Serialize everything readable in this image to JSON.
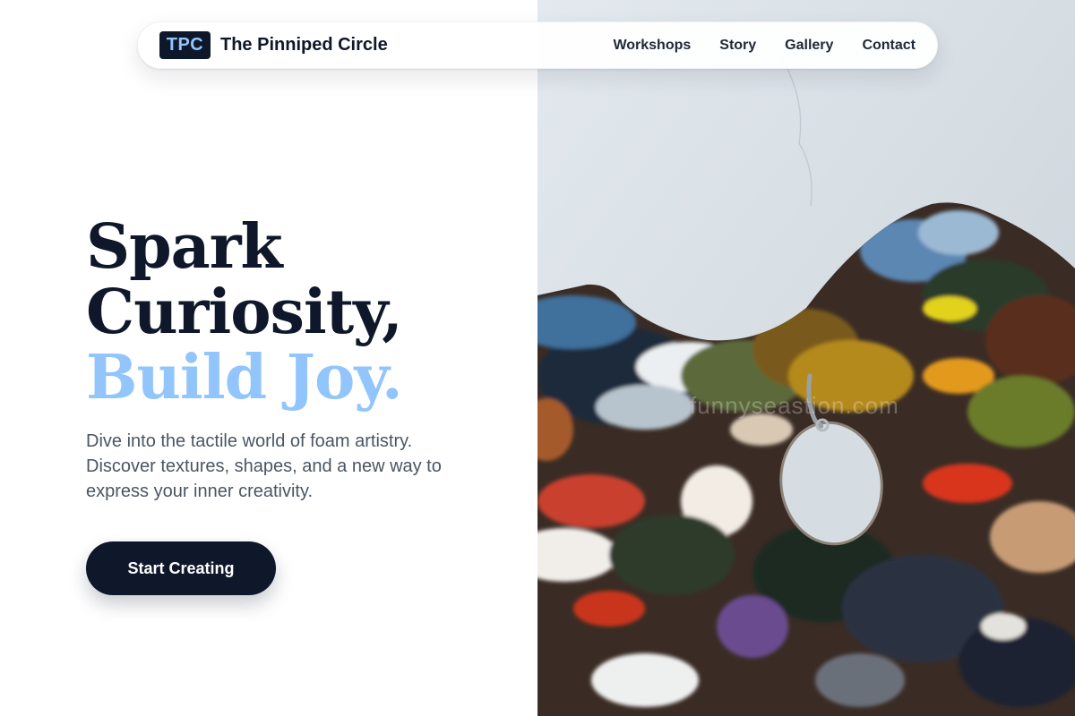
{
  "nav": {
    "logo_text": "TPC",
    "brand_name": "The Pinniped Circle",
    "links": [
      "Workshops",
      "Story",
      "Gallery",
      "Contact"
    ]
  },
  "hero": {
    "headline_line1": "Spark",
    "headline_line2": "Curiosity,",
    "headline_line3": "Build Joy.",
    "subtext": "Dive into the tactile world of foam artistry. Discover textures, shapes, and a new way to express your inner creativity.",
    "cta_label": "Start Creating"
  },
  "image": {
    "subject": "paint palette with thick colorful oil paint hanging on a wall",
    "watermark": "funnyseastion.com"
  },
  "colors": {
    "navy": "#0f172a",
    "accent_blue": "#93c5fd",
    "body_text": "#4b5563",
    "wall": "#d5dde3"
  },
  "icons": [
    "logo-mark"
  ]
}
